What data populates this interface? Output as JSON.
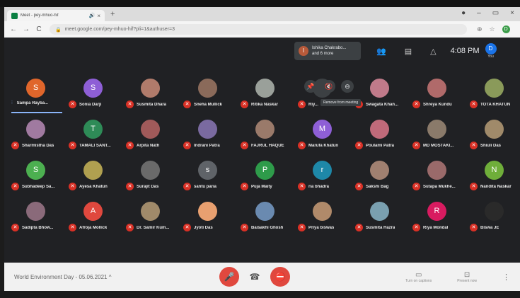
{
  "browser": {
    "tab_title": "Meet - pey-mhuo-hif",
    "tab_speaker_icon": "speaker-icon",
    "tab_close_glyph": "×",
    "new_tab_glyph": "+",
    "window_controls": [
      "●",
      "–",
      "▭",
      "×"
    ],
    "back_glyph": "←",
    "forward_glyph": "→",
    "reload_glyph": "C",
    "lock_glyph": "🔒",
    "url": "meet.google.com/pey-mhuo-hif?pli=1&authuser=3",
    "ext_glyphs": [
      "⊕",
      "☆"
    ],
    "profile_letter": "D"
  },
  "meet_header": {
    "presenter_name": "Ishika Chakrabo...",
    "presenter_more": "and 6 more",
    "clock": "4:08 PM",
    "you_letter": "D",
    "you_label": "You"
  },
  "hover_tooltip": "Remove from meeting",
  "participants": [
    {
      "name": "Sampa Rayba...",
      "initial": "S",
      "color": "#e0662b",
      "speaking": true
    },
    {
      "name": "Sonia Darji",
      "initial": "S",
      "color": "#8e5fd6"
    },
    {
      "name": "Susmita Dhara",
      "initial": "",
      "color": "#b07b6b"
    },
    {
      "name": "Sneha Mullick",
      "initial": "",
      "color": "#8a6a5a"
    },
    {
      "name": "Ritika Naskar",
      "initial": "",
      "color": "#9aa09a"
    },
    {
      "name": "Riy...",
      "initial": "",
      "color": "#3c4043"
    },
    {
      "name": "Swagata Khan...",
      "initial": "",
      "color": "#c07a8a"
    },
    {
      "name": "Shreya Kundu",
      "initial": "",
      "color": "#b06a6a"
    },
    {
      "name": "TOTA KHATUN",
      "initial": "",
      "color": "#8a9a5a"
    },
    {
      "name": "Sharmistha Das",
      "initial": "",
      "color": "#a07aa0"
    },
    {
      "name": "TAMALI SANT...",
      "initial": "T",
      "color": "#2e8b57"
    },
    {
      "name": "Arpita Nath",
      "initial": "",
      "color": "#a05a5a"
    },
    {
      "name": "Indrani Patra",
      "initial": "",
      "color": "#7a6aa0"
    },
    {
      "name": "FAJRUL HAQUE",
      "initial": "",
      "color": "#9a7a6a"
    },
    {
      "name": "Marufa Khatun",
      "initial": "M",
      "color": "#8e5fd6"
    },
    {
      "name": "Poulami Patra",
      "initial": "",
      "color": "#c06a7a"
    },
    {
      "name": "MD MOSTAKI...",
      "initial": "",
      "color": "#8a7a6a"
    },
    {
      "name": "Shiuli Das",
      "initial": "",
      "color": "#a08a6a"
    },
    {
      "name": "Subhadeep Sa...",
      "initial": "S",
      "color": "#4caf50"
    },
    {
      "name": "Ayesa Khatun",
      "initial": "",
      "color": "#b0a050"
    },
    {
      "name": "Surajit Das",
      "initial": "",
      "color": "#6a6a6a"
    },
    {
      "name": "santu paria",
      "initial": "s",
      "color": "#5f6368"
    },
    {
      "name": "Puja Maity",
      "initial": "P",
      "color": "#2e9b4a"
    },
    {
      "name": "ria bhadra",
      "initial": "r",
      "color": "#1e88a8"
    },
    {
      "name": "Sakshi Bag",
      "initial": "",
      "color": "#a08070"
    },
    {
      "name": "Sutapa Mukhe...",
      "initial": "",
      "color": "#9a6a6a"
    },
    {
      "name": "Nandita Naskar",
      "initial": "N",
      "color": "#6fae3a"
    },
    {
      "name": "Sadipta Bhow...",
      "initial": "",
      "color": "#8a6a7a"
    },
    {
      "name": "Afroja Mollick",
      "initial": "A",
      "color": "#e0483e"
    },
    {
      "name": "Dr. Samir Kum...",
      "initial": "",
      "color": "#a08a6a"
    },
    {
      "name": "Jyoti Das",
      "initial": "",
      "color": "#e8a070"
    },
    {
      "name": "Baisakhi Ghosh",
      "initial": "",
      "color": "#6a8ab0"
    },
    {
      "name": "Priya biswas",
      "initial": "",
      "color": "#b08a6a"
    },
    {
      "name": "Susmita Hazra",
      "initial": "",
      "color": "#7aa0b0"
    },
    {
      "name": "Riya Mondal",
      "initial": "R",
      "color": "#d81b60"
    },
    {
      "name": "Biswa JE",
      "initial": "",
      "color": "#2a2a2a"
    }
  ],
  "bottom": {
    "meeting_title": "World Environment Day - 05.06.2021",
    "details_glyph": "^",
    "mic_glyph": "🎤",
    "end_glyph": "☎",
    "cam_glyph": "⛔",
    "captions_label": "Turn on captions",
    "present_label": "Present now",
    "more_glyph": "⋮"
  }
}
